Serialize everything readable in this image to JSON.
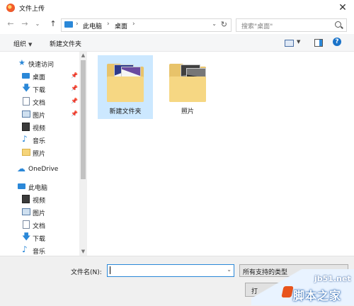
{
  "window": {
    "title": "文件上传",
    "close_glyph": "✕"
  },
  "nav": {
    "back_glyph": "←",
    "forward_glyph": "→",
    "recent_glyph": "⌄",
    "up_glyph": "↑",
    "breadcrumbs": [
      "此电脑",
      "桌面"
    ],
    "separator": "›",
    "dropdown_glyph": "⌄",
    "refresh_glyph": "↻",
    "search_placeholder": "搜索\"桌面\""
  },
  "toolbar": {
    "organize_label": "组织",
    "new_folder_label": "新建文件夹",
    "caret": "▼",
    "help_glyph": "?"
  },
  "sidebar": {
    "quick_access": "快速访问",
    "pinned_items": [
      {
        "label": "桌面",
        "icon": "desktop-icon",
        "pinned": true
      },
      {
        "label": "下载",
        "icon": "download-icon",
        "pinned": true
      },
      {
        "label": "文档",
        "icon": "document-icon",
        "pinned": true
      },
      {
        "label": "图片",
        "icon": "pictures-icon",
        "pinned": true
      },
      {
        "label": "视频",
        "icon": "video-icon",
        "pinned": false
      },
      {
        "label": "音乐",
        "icon": "music-icon",
        "pinned": false
      },
      {
        "label": "照片",
        "icon": "folder-icon",
        "pinned": false
      }
    ],
    "onedrive": "OneDrive",
    "this_pc": "此电脑",
    "pc_items": [
      {
        "label": "视频",
        "icon": "video-icon"
      },
      {
        "label": "图片",
        "icon": "pictures-icon"
      },
      {
        "label": "文档",
        "icon": "document-icon"
      },
      {
        "label": "下载",
        "icon": "download-icon"
      },
      {
        "label": "音乐",
        "icon": "music-icon"
      }
    ],
    "pin_glyph": "📌"
  },
  "files": [
    {
      "name": "新建文件夹",
      "selected": true
    },
    {
      "name": "照片",
      "selected": false
    }
  ],
  "bottom": {
    "filename_label": "文件名(N):",
    "filename_value": "",
    "filetype_value": "所有支持的类型",
    "open_label": "打",
    "dropdown_glyph": "⌄"
  },
  "watermark": {
    "site": "jb51.net",
    "name": "脚本之家"
  },
  "colors": {
    "accent": "#2b88d8",
    "selection": "#cce8ff",
    "folder": "#f6d783"
  }
}
